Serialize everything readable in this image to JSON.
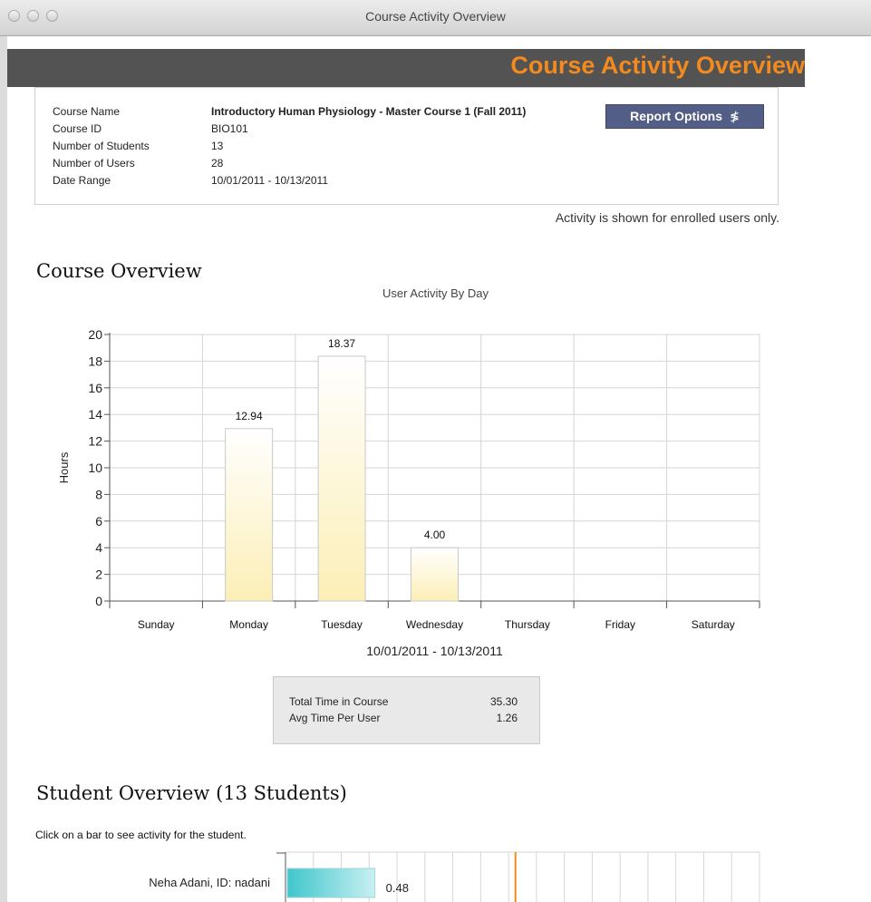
{
  "window": {
    "title": "Course Activity Overview"
  },
  "banner": {
    "title": "Course Activity Overview"
  },
  "course_info": {
    "rows": [
      {
        "label": "Course Name",
        "value": "Introductory Human Physiology - Master Course 1 (Fall 2011)"
      },
      {
        "label": "Course ID",
        "value": "BIO101"
      },
      {
        "label": "Number of Students",
        "value": "13"
      },
      {
        "label": "Number of Users",
        "value": "28"
      },
      {
        "label": "Date Range",
        "value": "10/01/2011 - 10/13/2011"
      }
    ],
    "report_options_label": "Report Options",
    "report_options_icon": "double-chevron-down-icon"
  },
  "activity_note": "Activity is shown for enrolled users only.",
  "course_overview": {
    "heading": "Course Overview",
    "stats": [
      {
        "label": "Total Time in Course",
        "value": "35.30"
      },
      {
        "label": "Avg Time Per User",
        "value": "1.26"
      }
    ]
  },
  "chart_data": {
    "type": "bar",
    "title": "User Activity By Day",
    "xlabel": "10/01/2011 - 10/13/2011",
    "ylabel": "Hours",
    "categories": [
      "Sunday",
      "Monday",
      "Tuesday",
      "Wednesday",
      "Thursday",
      "Friday",
      "Saturday"
    ],
    "values": [
      0,
      12.94,
      18.37,
      4.0,
      0,
      0,
      0
    ],
    "labels": [
      "",
      "12.94",
      "18.37",
      "4.00",
      "",
      "",
      ""
    ],
    "ylim": [
      0,
      20
    ],
    "yticks": [
      0,
      2,
      4,
      6,
      8,
      10,
      12,
      14,
      16,
      18,
      20
    ],
    "grid": true,
    "bar_color_top": "#ffffff",
    "bar_color_bottom": "#fcefb6"
  },
  "student_overview": {
    "heading": "Student Overview (13 Students)",
    "instruction": "Click on a bar to see activity for the student.",
    "students": [
      {
        "label": "Neha Adani, ID: nadani",
        "hours": 0.48,
        "value_label": "0.48"
      }
    ],
    "bar_color": "#3fc6cc",
    "marker_color": "#f28a1d"
  },
  "colors": {
    "accent": "#f28a1d",
    "banner_bg": "#535353",
    "button_bg": "#535e86"
  }
}
